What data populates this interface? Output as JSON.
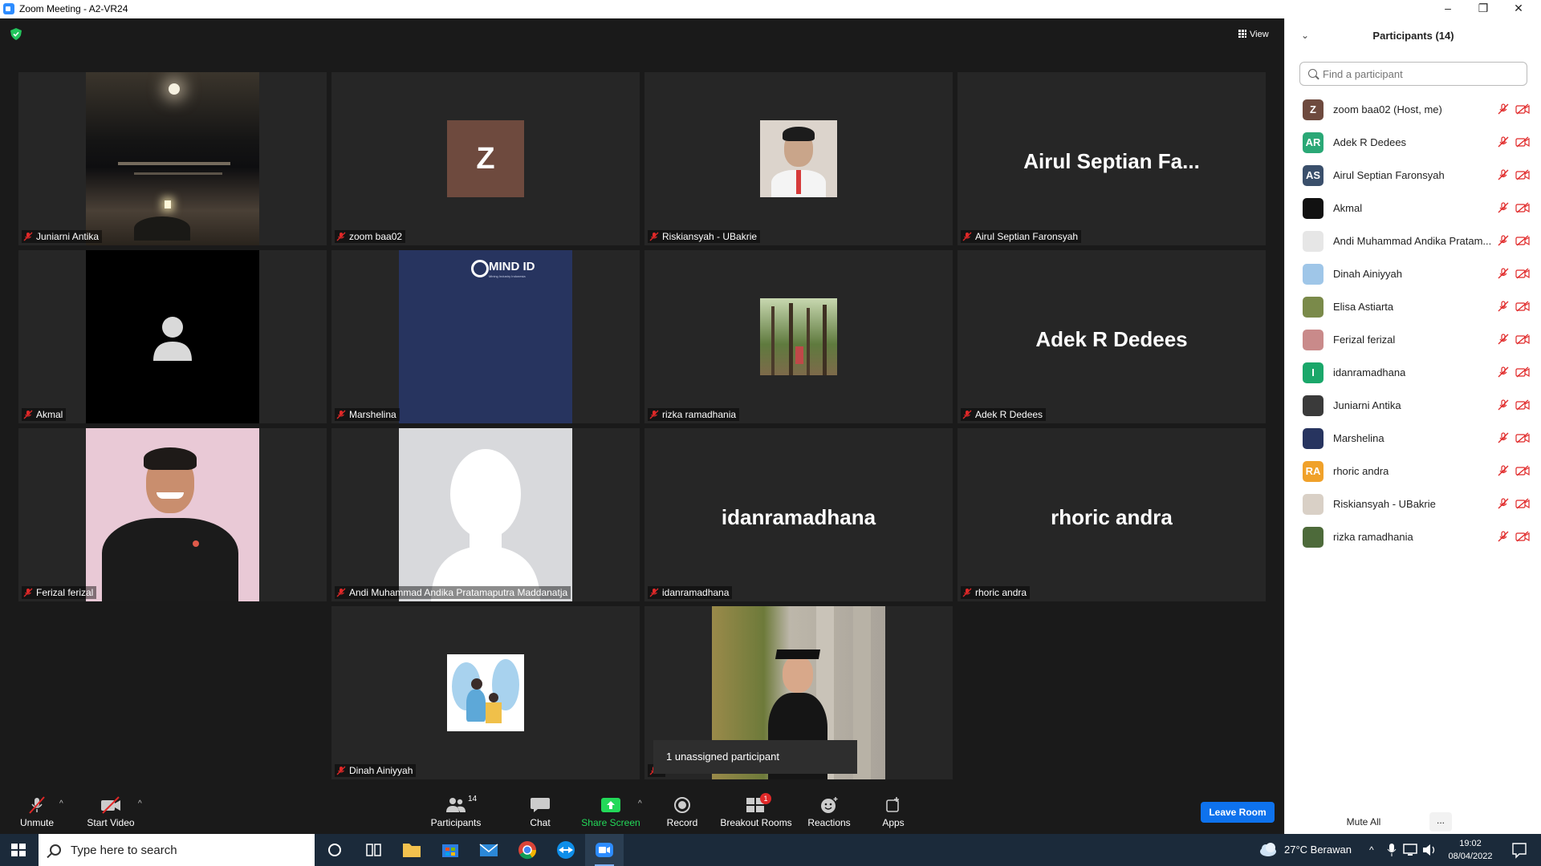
{
  "window": {
    "title": "Zoom Meeting - A2-VR24",
    "controls": [
      "–",
      "❐",
      "✕"
    ]
  },
  "view_button": "View",
  "tiles": [
    {
      "name": "Juniarni Antika"
    },
    {
      "name": "zoom baa02",
      "avatar_letter": "Z"
    },
    {
      "name": "Riskiansyah - UBakrie"
    },
    {
      "name": "Airul Septian Faronsyah",
      "big_name": "Airul Septian Fa..."
    },
    {
      "name": "Akmal"
    },
    {
      "name": "Marshelina",
      "logo_text": "MIND ID",
      "logo_sub": "Mining Industry Indonesia"
    },
    {
      "name": "rizka ramadhania"
    },
    {
      "name": "Adek R Dedees",
      "big_name": "Adek R Dedees"
    },
    {
      "name": "Ferizal ferizal"
    },
    {
      "name": "Andi Muhammad Andika Pratamaputra Maddanatja"
    },
    {
      "name": "idanramadhana",
      "big_name": "idanramadhana"
    },
    {
      "name": "rhoric andra",
      "big_name": "rhoric andra"
    },
    {
      "name": "Dinah Ainiyyah"
    },
    {
      "name": ""
    }
  ],
  "tooltip": "1 unassigned participant",
  "toolbar": {
    "unmute": "Unmute",
    "start_video": "Start Video",
    "participants": "Participants",
    "participants_count": "14",
    "chat": "Chat",
    "share_screen": "Share Screen",
    "record": "Record",
    "breakout_rooms": "Breakout Rooms",
    "breakout_badge": "1",
    "reactions": "Reactions",
    "apps": "Apps",
    "leave": "Leave Room"
  },
  "panel": {
    "title": "Participants (14)",
    "search_placeholder": "Find a participant",
    "participants": [
      {
        "name": "zoom baa02 (Host, me)",
        "initials": "Z",
        "color": "#6e4a3e"
      },
      {
        "name": "Adek R Dedees",
        "initials": "AR",
        "color": "#2aa876"
      },
      {
        "name": "Airul Septian Faronsyah",
        "initials": "AS",
        "color": "#3a4f6b"
      },
      {
        "name": "Akmal",
        "initials": "",
        "color": "#111111"
      },
      {
        "name": "Andi Muhammad Andika Pratam...",
        "initials": "",
        "color": "#e6e6e6"
      },
      {
        "name": "Dinah Ainiyyah",
        "initials": "",
        "color": "#9fc6e8"
      },
      {
        "name": "Elisa Astiarta",
        "initials": "",
        "color": "#7a8a4a"
      },
      {
        "name": "Ferizal ferizal",
        "initials": "",
        "color": "#c98a8a"
      },
      {
        "name": "idanramadhana",
        "initials": "I",
        "color": "#1aa76a"
      },
      {
        "name": "Juniarni Antika",
        "initials": "",
        "color": "#3a3a3a"
      },
      {
        "name": "Marshelina",
        "initials": "",
        "color": "#27345f"
      },
      {
        "name": "rhoric andra",
        "initials": "RA",
        "color": "#f0a12a"
      },
      {
        "name": "Riskiansyah - UBakrie",
        "initials": "",
        "color": "#d9d0c6"
      },
      {
        "name": "rizka ramadhania",
        "initials": "",
        "color": "#4d6a3a"
      }
    ],
    "mute_all": "Mute All",
    "more": "..."
  },
  "taskbar": {
    "search_placeholder": "Type here to search",
    "weather": "27°C  Berawan",
    "time": "19:02",
    "date": "08/04/2022"
  },
  "colors": {
    "accent": "#0e72ed",
    "muted_red": "#e02828",
    "share_green": "#23d959"
  }
}
